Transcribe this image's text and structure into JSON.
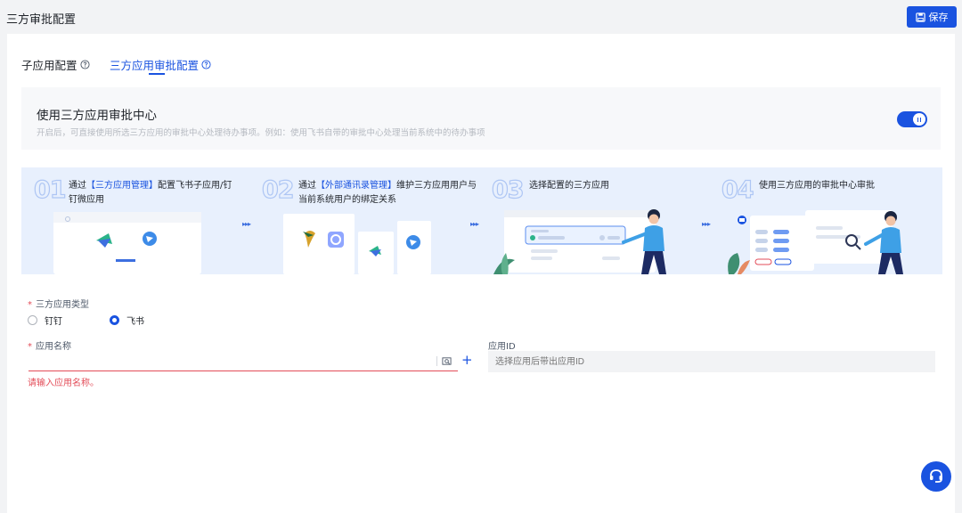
{
  "header": {
    "title": "三方审批配置",
    "save_label": "保存"
  },
  "tabs": [
    {
      "label": "子应用配置",
      "active": false
    },
    {
      "label": "三方应用审批配置",
      "active": true
    }
  ],
  "approval_center": {
    "title": "使用三方应用审批中心",
    "description": "开启后，可直接使用所选三方应用的审批中心处理待办事项。例如：使用飞书自带的审批中心处理当前系统中的待办事项",
    "enabled": true
  },
  "steps": [
    {
      "num": "01",
      "pre": "通过",
      "highlight": "【三方应用管理】",
      "post": "配置飞书子应用/钉钉微应用"
    },
    {
      "num": "02",
      "pre": "通过",
      "highlight": "【外部通讯录管理】",
      "post": "维护三方应用用户与当前系统用户的绑定关系"
    },
    {
      "num": "03",
      "pre": "选择配置的三方应用",
      "highlight": "",
      "post": ""
    },
    {
      "num": "04",
      "pre": "使用三方应用的审批中心审批",
      "highlight": "",
      "post": ""
    }
  ],
  "form": {
    "required_mark": "*",
    "app_type_label": "三方应用类型",
    "app_type_options": [
      {
        "label": "钉钉",
        "checked": false
      },
      {
        "label": "飞书",
        "checked": true
      }
    ],
    "app_name_label": "应用名称",
    "app_name_value": "",
    "app_name_error": "请输入应用名称。",
    "app_id_label": "应用ID",
    "app_id_placeholder": "选择应用后带出应用ID"
  },
  "colors": {
    "primary": "#1a53e0",
    "error": "#e34d59",
    "steps_bg": "#e8f0fd"
  }
}
